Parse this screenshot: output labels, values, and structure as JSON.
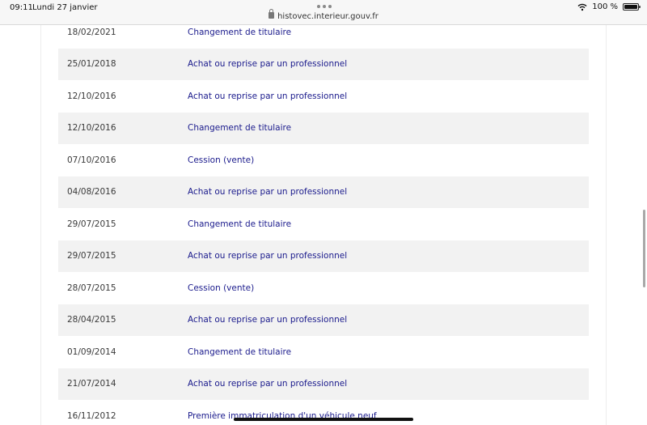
{
  "statusbar": {
    "time": "09:11",
    "date": "Lundi 27 janvier",
    "url": "histovec.interieur.gouv.fr",
    "battery": "100 %"
  },
  "history": [
    {
      "date": "18/02/2021",
      "operation": "Changement de titulaire"
    },
    {
      "date": "25/01/2018",
      "operation": "Achat ou reprise par un professionnel"
    },
    {
      "date": "12/10/2016",
      "operation": "Achat ou reprise par un professionnel"
    },
    {
      "date": "12/10/2016",
      "operation": "Changement de titulaire"
    },
    {
      "date": "07/10/2016",
      "operation": "Cession (vente)"
    },
    {
      "date": "04/08/2016",
      "operation": "Achat ou reprise par un professionnel"
    },
    {
      "date": "29/07/2015",
      "operation": "Changement de titulaire"
    },
    {
      "date": "29/07/2015",
      "operation": "Achat ou reprise par un professionnel"
    },
    {
      "date": "28/07/2015",
      "operation": "Cession (vente)"
    },
    {
      "date": "28/04/2015",
      "operation": "Achat ou reprise par un professionnel"
    },
    {
      "date": "01/09/2014",
      "operation": "Changement de titulaire"
    },
    {
      "date": "21/07/2014",
      "operation": "Achat ou reprise par un professionnel"
    },
    {
      "date": "16/11/2012",
      "operation": "Première immatriculation d'un véhicule neuf"
    }
  ],
  "colors": {
    "link": "#1a1a8c",
    "row_alt": "#f2f2f2"
  }
}
